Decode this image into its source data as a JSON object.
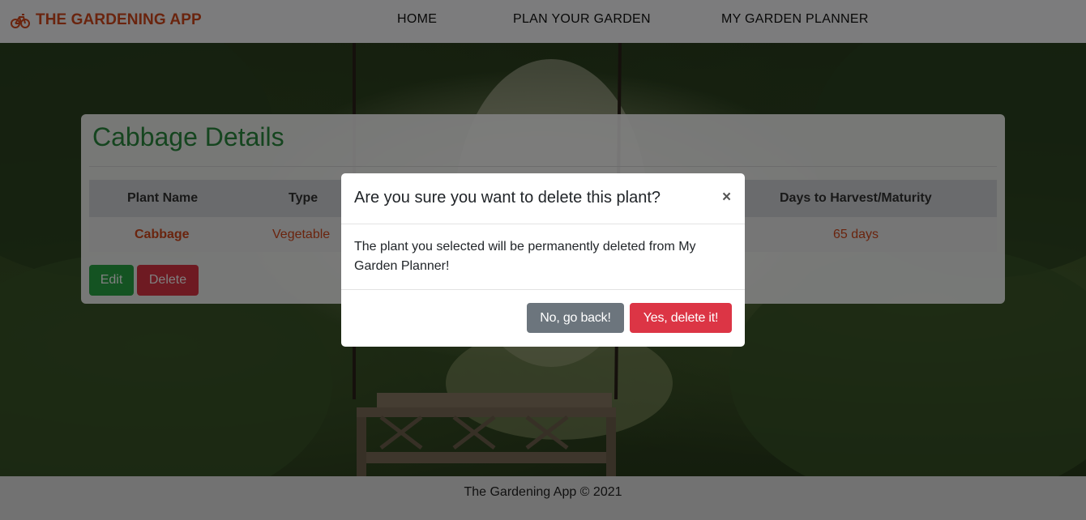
{
  "brand": {
    "name": "THE GARDENING APP",
    "icon": "bicycle-icon",
    "color": "#d4491c"
  },
  "nav": {
    "home": "HOME",
    "plan": "PLAN YOUR GARDEN",
    "planner": "MY GARDEN PLANNER"
  },
  "card": {
    "title": "Cabbage Details",
    "headers": [
      "Plant Name",
      "Type",
      "Days to Harvest/Maturity"
    ],
    "row": {
      "name": "Cabbage",
      "type": "Vegetable",
      "days": "65 days"
    },
    "edit_label": "Edit",
    "delete_label": "Delete"
  },
  "modal": {
    "title": "Are you sure you want to delete this plant?",
    "close": "×",
    "body": "The plant you selected will be permanently deleted from My Garden Planner!",
    "back_label": "No, go back!",
    "confirm_label": "Yes, delete it!"
  },
  "footer": {
    "text": "The Gardening App © 2021"
  },
  "colors": {
    "accent": "#d4491c",
    "title_green": "#2a8a3e",
    "success": "#28a745",
    "danger": "#dc3545",
    "secondary": "#6c757d"
  }
}
